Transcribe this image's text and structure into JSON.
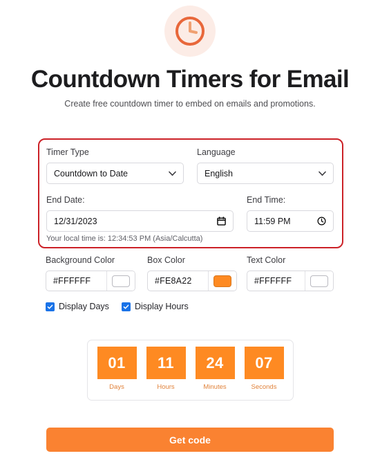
{
  "page": {
    "logo_icon": "clock-icon",
    "title": "Countdown Timers for Email",
    "subtitle": "Create free countdown timer to embed on emails and promotions."
  },
  "form": {
    "timer_type": {
      "label": "Timer Type",
      "value": "Countdown to Date",
      "icon": "chevron-down-icon"
    },
    "language": {
      "label": "Language",
      "value": "English",
      "icon": "chevron-down-icon"
    },
    "end_date": {
      "label": "End Date:",
      "value": "12/31/2023",
      "icon": "calendar-icon"
    },
    "end_time": {
      "label": "End Time:",
      "value": "11:59 PM",
      "icon": "clock-icon"
    },
    "local_time_note": "Your local time is: 12:34:53 PM (Asia/Calcutta)",
    "highlight_border_color": "#CC2127"
  },
  "colors": {
    "background": {
      "label": "Background Color",
      "value": "#FFFFFF",
      "swatch": "#FFFFFF"
    },
    "box": {
      "label": "Box Color",
      "value": "#FE8A22",
      "swatch": "#FE8A22"
    },
    "text": {
      "label": "Text Color",
      "value": "#FFFFFF",
      "swatch": "#FFFFFF"
    }
  },
  "options": {
    "accent": "#1A73E8",
    "items": [
      {
        "label": "Display Days",
        "checked": true
      },
      {
        "label": "Display Hours",
        "checked": true
      }
    ]
  },
  "preview": {
    "box_color": "#FE8A22",
    "text_color": "#FFFFFF",
    "units": [
      {
        "value": "01",
        "caption": "Days"
      },
      {
        "value": "11",
        "caption": "Hours"
      },
      {
        "value": "24",
        "caption": "Minutes"
      },
      {
        "value": "07",
        "caption": "Seconds"
      }
    ]
  },
  "cta": {
    "label": "Get code",
    "color": "#FA8231"
  }
}
